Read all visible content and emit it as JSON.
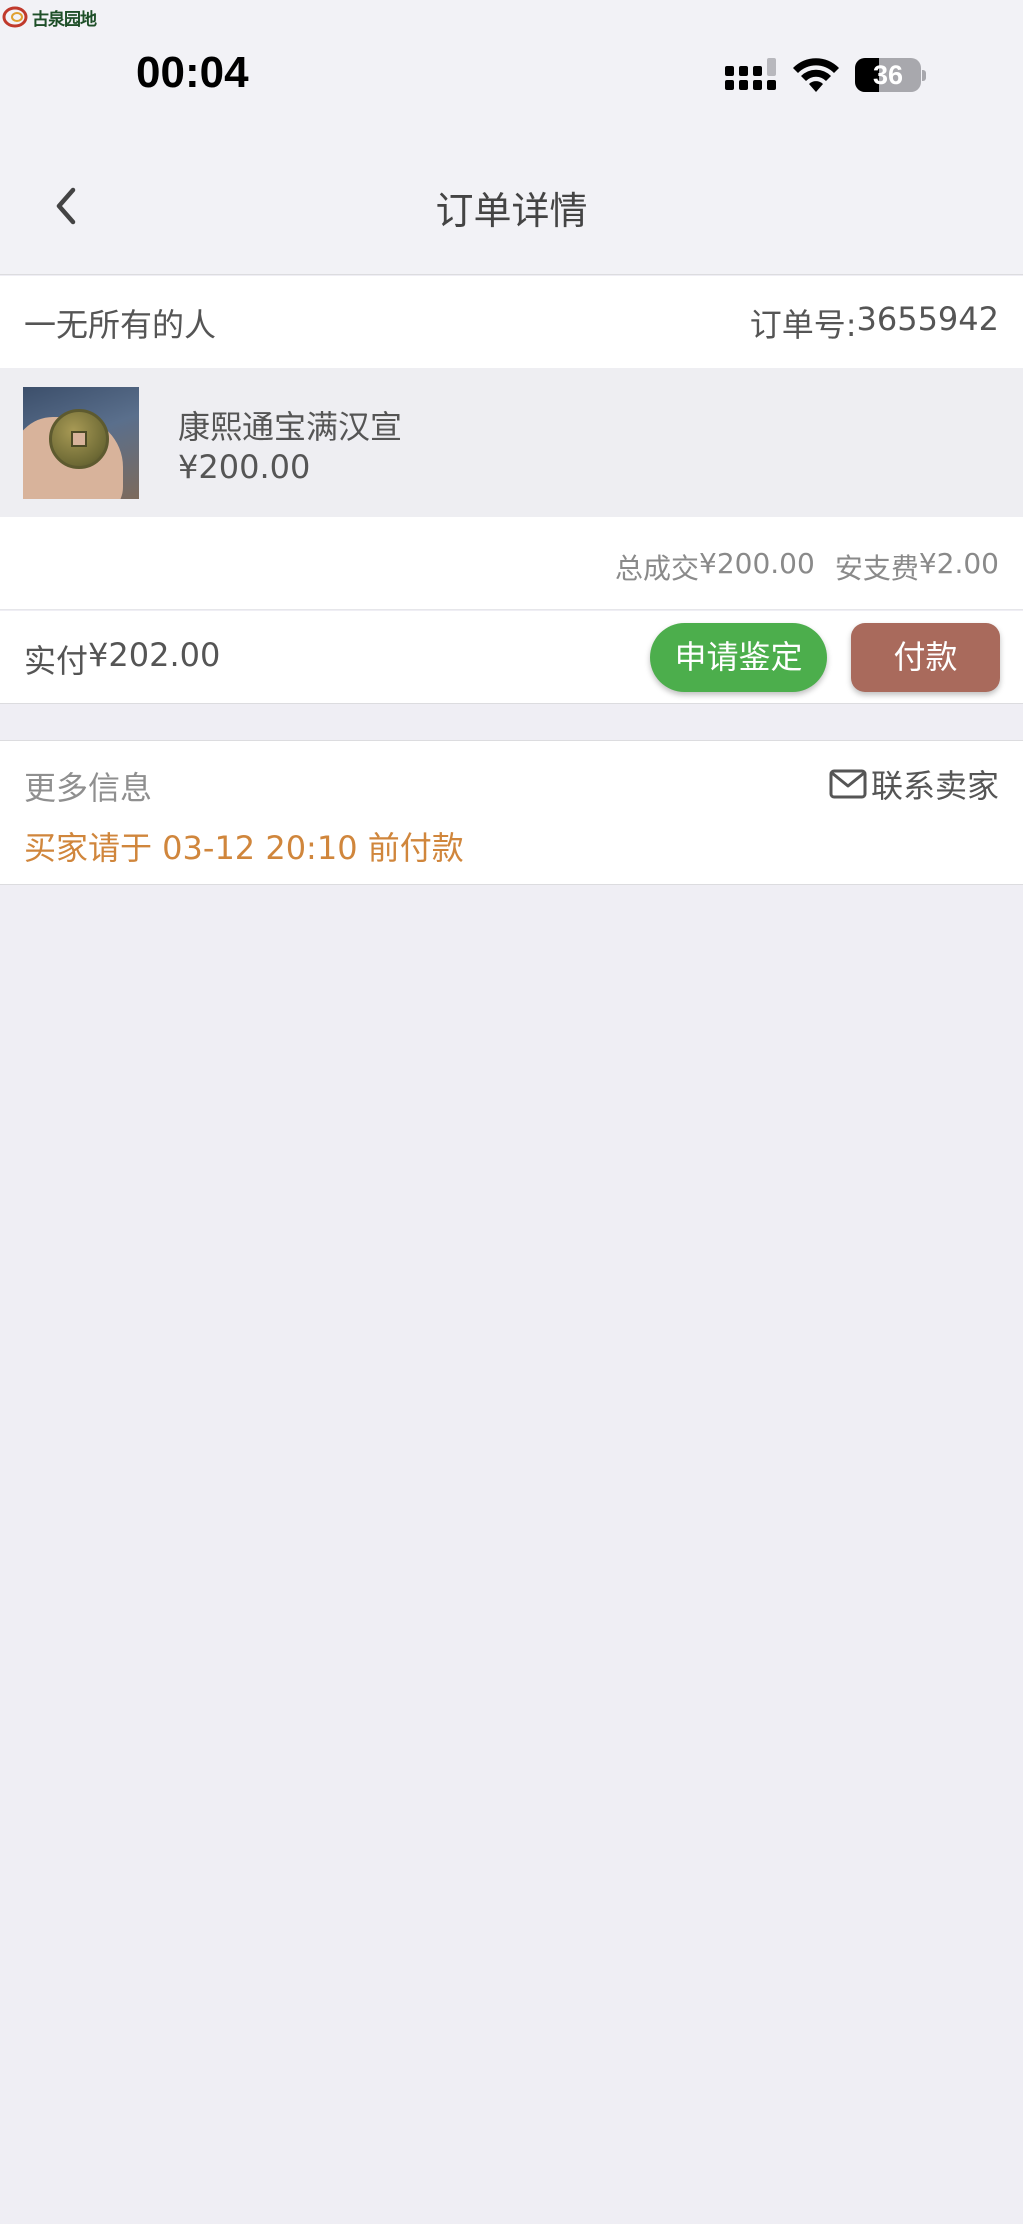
{
  "watermark": {
    "text": "古泉园地"
  },
  "status_bar": {
    "time": "00:04",
    "battery": "36",
    "battery_level": 0.36
  },
  "nav": {
    "title": "订单详情"
  },
  "order": {
    "seller": "一无所有的人",
    "order_no_label": "订单号:",
    "order_no": "3655942",
    "item": {
      "name": "康熙通宝满汉宣",
      "currency": "¥",
      "price": "200.00"
    },
    "total_label": "总成交",
    "total": "¥200.00",
    "fee_label": "安支费",
    "fee": "¥2.00",
    "paid_label": "实付",
    "paid": "¥202.00",
    "buttons": {
      "appraise": "申请鉴定",
      "pay": "付款"
    }
  },
  "more_info": {
    "title": "更多信息",
    "contact": "联系卖家",
    "deadline": "买家请于 03-12 20:10 前付款"
  },
  "colors": {
    "appraise_button": "#4cae4c",
    "pay_button": "#a96a5c",
    "deadline_text": "#d0863c",
    "background": "#efeef4"
  }
}
